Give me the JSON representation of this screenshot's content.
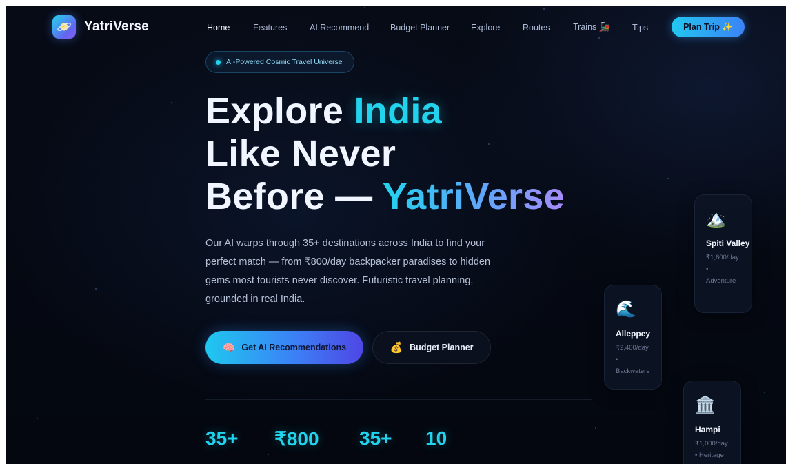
{
  "brand": {
    "name": "YatriVerse",
    "logo_icon": "planet-icon"
  },
  "nav": {
    "links": [
      "Home",
      "Features",
      "AI Recommend",
      "Budget Planner",
      "Explore",
      "Routes",
      "Trains 🚂",
      "Tips"
    ],
    "active": "Home",
    "cta": "Plan Trip ✨"
  },
  "badge": {
    "text": "AI-Powered Cosmic Travel Universe"
  },
  "hero": {
    "line1_a": "Explore ",
    "line1_b": "India",
    "line2": "Like Never",
    "line3_a": "Before — ",
    "line3_b": "YatriVerse",
    "description": "Our AI warps through 35+ destinations across India to find your perfect match — from ₹800/day backpacker paradises to hidden gems most tourists never discover. Futuristic travel planning, grounded in real India."
  },
  "cta": {
    "primary_icon": "🧠",
    "primary_label": "Get AI Recommendations",
    "secondary_icon": "💰",
    "secondary_label": "Budget Planner"
  },
  "stats": [
    "35+",
    "₹800",
    "35+",
    "10"
  ],
  "cards": [
    {
      "icon": "🏔️",
      "icon_name": "mountain-icon",
      "name": "Spiti Valley",
      "price": "₹1,600/day",
      "sep": "•",
      "tag": "Adventure"
    },
    {
      "icon": "🌊",
      "icon_name": "wave-icon",
      "name": "Alleppey",
      "price": "₹2,400/day",
      "sep": "•",
      "tag": "Backwaters"
    },
    {
      "icon": "🏛️",
      "icon_name": "temple-icon",
      "name": "Hampi",
      "price": "₹1,000/day",
      "sep": "",
      "tag": "• Heritage"
    }
  ],
  "colors": {
    "accent_cyan": "#22d3ee",
    "accent_blue": "#3b82f6",
    "accent_violet": "#a78bfa",
    "background": "#060a14"
  }
}
